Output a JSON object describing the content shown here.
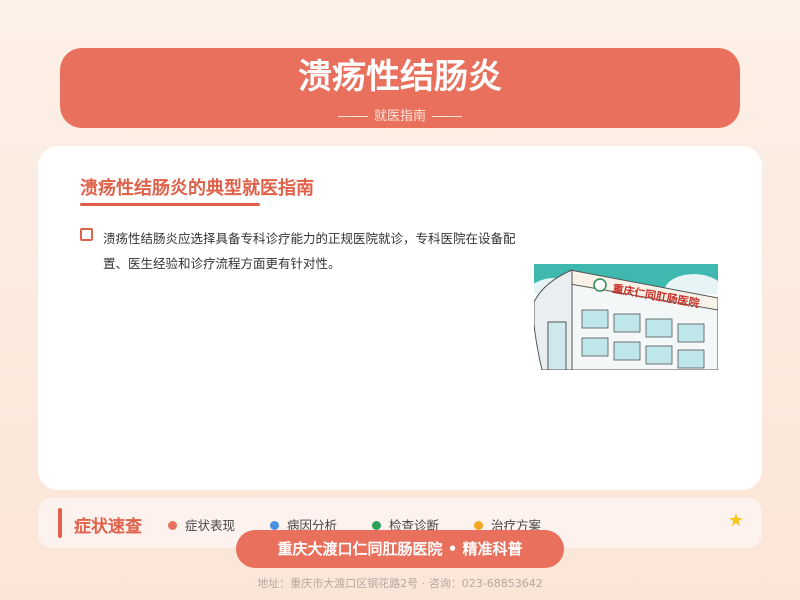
{
  "header": {
    "title": "溃疡性结肠炎",
    "subtitle": "就医指南"
  },
  "card": {
    "heading": "溃疡性结肠炎的典型就医指南",
    "items": [
      {
        "text": "溃疡性结肠炎应选择具备专科诊疗能力的正规医院就诊，专科医院在设备配置、医生经验和诊疗流程方面更有针对性。"
      }
    ],
    "hospital_sign": "重庆仁同肛肠医院"
  },
  "bottom_bar": {
    "label": "症状速查",
    "tags": [
      {
        "label": "症状表现",
        "color": "#e8705c"
      },
      {
        "label": "病因分析",
        "color": "#4a90e2"
      },
      {
        "label": "检查诊断",
        "color": "#2e9e5b"
      },
      {
        "label": "治疗方案",
        "color": "#f5a623"
      }
    ],
    "star": "★"
  },
  "badge": "重庆大渡口仁同肛肠医院 • 精准科普",
  "footer": "地址：重庆市大渡口区钢花路2号 · 咨询：023-68853642"
}
